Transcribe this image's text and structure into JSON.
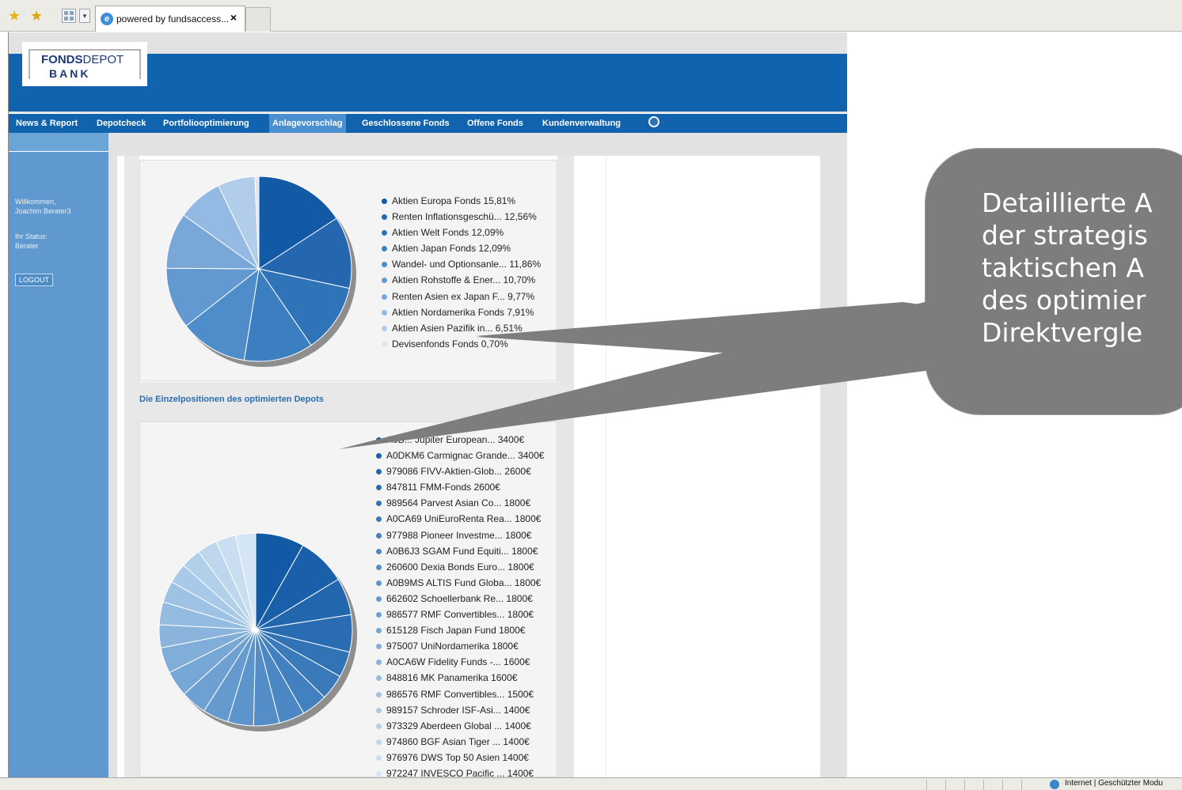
{
  "browser": {
    "tab_title": "powered by fundsaccess...",
    "close_glyph": "×"
  },
  "logo": {
    "line1_bold": "FONDS",
    "line1_rest": "DEPOT",
    "line2": "BANK"
  },
  "nav": {
    "items": [
      {
        "label": "News & Report"
      },
      {
        "label": "Depotcheck"
      },
      {
        "label": "Portfoliooptimierung"
      },
      {
        "label": "Anlagevorschlag",
        "active": true
      },
      {
        "label": "Geschlossene Fonds"
      },
      {
        "label": "Offene Fonds"
      },
      {
        "label": "Kundenverwaltung"
      }
    ]
  },
  "sidebar": {
    "welcome": "Willkommen,",
    "user": "Joachim Berater3",
    "status_label": "Ihr Status:",
    "status_value": "Berater",
    "logout": "LOGOUT"
  },
  "section_title": "Die Einzelpositionen des optimierten Depots",
  "chart_data": [
    {
      "type": "pie",
      "labels": [
        "Aktien Europa Fonds 15,81%",
        "Renten Inflationsgeschü... 12,56%",
        "Aktien Welt Fonds 12,09%",
        "Aktien Japan Fonds 12,09%",
        "Wandel- und Optionsanle... 11,86%",
        "Aktien Rohstoffe & Ener... 10,70%",
        "Renten Asien ex Japan F... 9,77%",
        "Aktien Nordamerika Fonds 7,91%",
        "Aktien Asien Pazifik in... 6,51%",
        "Devisenfonds Fonds 0,70%"
      ],
      "values": [
        15.81,
        12.56,
        12.09,
        12.09,
        11.86,
        10.7,
        9.77,
        7.91,
        6.51,
        0.7
      ],
      "colors": [
        "#1259a6",
        "#2467ae",
        "#2f73b8",
        "#3b7fc1",
        "#4f8cca",
        "#6399d1",
        "#79a8d8",
        "#93bae2",
        "#b2cdea",
        "#dde7f3"
      ]
    },
    {
      "type": "pie",
      "labels": [
        "A0B... Jupiter European... 3400€",
        "A0DKM6 Carmignac Grande... 3400€",
        "979086 FIVV-Aktien-Glob... 2600€",
        "847811 FMM-Fonds 2600€",
        "989564 Parvest Asian Co... 1800€",
        "A0CA69 UniEuroRenta Rea... 1800€",
        "977988 Pioneer Investme... 1800€",
        "A0B6J3 SGAM Fund Equiti... 1800€",
        "260600 Dexia Bonds Euro... 1800€",
        "A0B9MS ALTIS Fund Globa... 1800€",
        "662602 Schoellerbank Re... 1800€",
        "986577 RMF Convertibles... 1800€",
        "615128 Fisch Japan Fund 1800€",
        "975007 UniNordamerika 1800€",
        "A0CA6W Fidelity Funds -... 1600€",
        "848816 MK Panamerika 1600€",
        "986576 RMF Convertibles... 1500€",
        "989157 Schroder ISF-Asi... 1400€",
        "973329 Aberdeen Global ... 1400€",
        "974860 BGF Asian Tiger ... 1400€",
        "976976 DWS Top 50 Asien 1400€",
        "972247 INVESCO Pacific ... 1400€"
      ],
      "values": [
        3400,
        3400,
        2600,
        2600,
        1800,
        1800,
        1800,
        1800,
        1800,
        1800,
        1800,
        1800,
        1800,
        1800,
        1600,
        1600,
        1500,
        1400,
        1400,
        1400,
        1400,
        1400
      ],
      "colors": [
        "#1259a6",
        "#1a5fa9",
        "#2266ad",
        "#2a6cb1",
        "#3273b6",
        "#3b7aba",
        "#4380bf",
        "#4b87c3",
        "#548dc7",
        "#5c94cb",
        "#659ace",
        "#6ea1d2",
        "#77a7d5",
        "#80aed9",
        "#8ab4dc",
        "#94bbe0",
        "#9ec2e3",
        "#a8c9e7",
        "#b3d0ea",
        "#bed7ee",
        "#c9def1",
        "#d4e5f5"
      ]
    }
  ],
  "bubble": {
    "lines": [
      "Detaillierte A",
      "der strategis",
      "taktischen A",
      "des optimier",
      "Direktvergle"
    ]
  },
  "statusbar": {
    "zone": "Internet | Geschützter Modu"
  }
}
